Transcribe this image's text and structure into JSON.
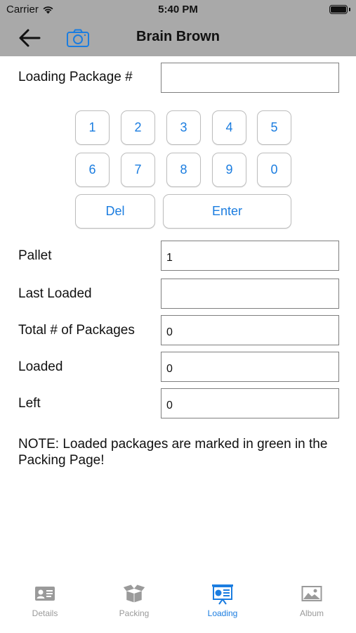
{
  "status": {
    "carrier": "Carrier",
    "time": "5:40 PM"
  },
  "nav": {
    "title": "Brain Brown",
    "back_icon": "arrow-left-icon",
    "camera_icon": "camera-icon"
  },
  "form": {
    "package_label": "Loading Package #",
    "package_value": "",
    "pallet_label": "Pallet",
    "pallet_value": "1",
    "last_loaded_label": "Last Loaded",
    "last_loaded_value": "",
    "total_label": "Total # of Packages",
    "total_value": "0",
    "loaded_label": "Loaded",
    "loaded_value": "0",
    "left_label": "Left",
    "left_value": "0"
  },
  "keypad": {
    "keys": [
      "1",
      "2",
      "3",
      "4",
      "5",
      "6",
      "7",
      "8",
      "9",
      "0"
    ],
    "del_label": "Del",
    "enter_label": "Enter"
  },
  "note": "NOTE: Loaded packages are marked in  green in the Packing Page!",
  "tabs": [
    {
      "label": "Details",
      "icon": "id-card-icon",
      "active": false
    },
    {
      "label": "Packing",
      "icon": "box-icon",
      "active": false
    },
    {
      "label": "Loading",
      "icon": "presentation-board-icon",
      "active": true
    },
    {
      "label": "Album",
      "icon": "photo-icon",
      "active": false
    }
  ],
  "colors": {
    "accent": "#1b7de0",
    "nav_bg": "#a9a9a9",
    "tab_inactive": "#9a9a9a"
  }
}
